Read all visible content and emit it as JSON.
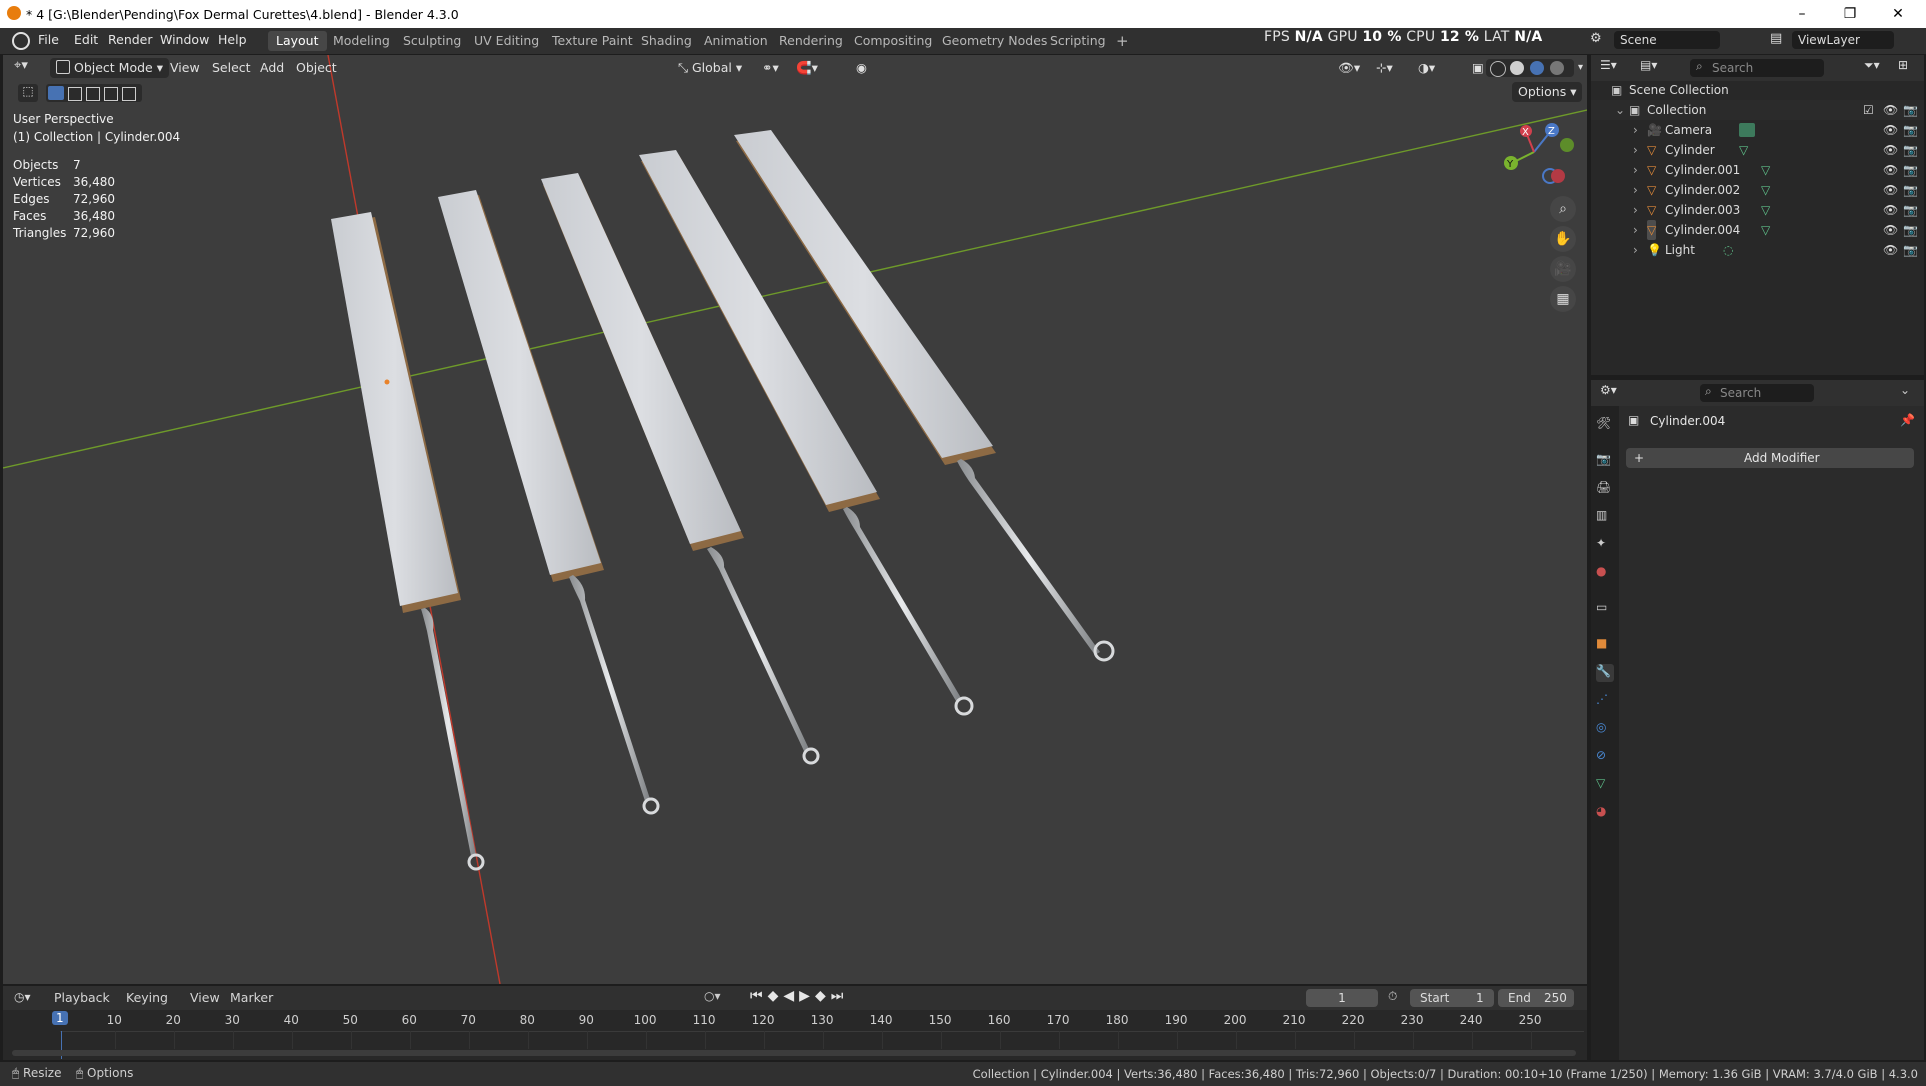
{
  "window": {
    "title": "* 4 [G:\\Blender\\Pending\\Fox Dermal Curettes\\4.blend] - Blender 4.3.0",
    "controls": [
      "–",
      "❐",
      "✕"
    ]
  },
  "menus": [
    "File",
    "Edit",
    "Render",
    "Window",
    "Help"
  ],
  "workspaces": [
    "Layout",
    "Modeling",
    "Sculpting",
    "UV Editing",
    "Texture Paint",
    "Shading",
    "Animation",
    "Rendering",
    "Compositing",
    "Geometry Nodes",
    "Scripting"
  ],
  "active_workspace": "Layout",
  "workspace_add": "+",
  "perf": {
    "fps_label": "FPS",
    "fps": "N/A",
    "gpu_label": "GPU",
    "gpu": "10 %",
    "cpu_label": "CPU",
    "cpu": "12 %",
    "lat_label": "LAT",
    "lat": "N/A"
  },
  "scene": {
    "label": "Scene",
    "view_layer": "ViewLayer"
  },
  "viewport": {
    "mode": "Object Mode",
    "menu": [
      "View",
      "Select",
      "Add",
      "Object"
    ],
    "orientation": "Global",
    "options_label": "Options",
    "perspective": "User Perspective",
    "context": "(1) Collection | Cylinder.004",
    "stats": [
      {
        "label": "Objects",
        "value": "7"
      },
      {
        "label": "Vertices",
        "value": "36,480"
      },
      {
        "label": "Edges",
        "value": "72,960"
      },
      {
        "label": "Faces",
        "value": "36,480"
      },
      {
        "label": "Triangles",
        "value": "72,960"
      }
    ],
    "gizmo": {
      "x": "X",
      "y": "Y",
      "z": "Z"
    }
  },
  "outliner": {
    "search_placeholder": "Search",
    "scene_collection": "Scene Collection",
    "collection": "Collection",
    "items": [
      "Camera",
      "Cylinder",
      "Cylinder.001",
      "Cylinder.002",
      "Cylinder.003",
      "Cylinder.004",
      "Light"
    ]
  },
  "properties": {
    "search_placeholder": "Search",
    "object_name": "Cylinder.004",
    "add_modifier": "Add Modifier",
    "add_icon": "+"
  },
  "timeline": {
    "menus": [
      "Playback",
      "Keying",
      "View",
      "Marker"
    ],
    "current_frame": "1",
    "start_label": "Start",
    "start": "1",
    "end_label": "End",
    "end": "250",
    "ticks": [
      "1",
      "10",
      "20",
      "30",
      "40",
      "50",
      "60",
      "70",
      "80",
      "90",
      "100",
      "110",
      "120",
      "130",
      "140",
      "150",
      "160",
      "170",
      "180",
      "190",
      "200",
      "210",
      "220",
      "230",
      "240",
      "250"
    ]
  },
  "statusbar": {
    "left": [
      "Resize",
      "Options"
    ],
    "right": "Collection | Cylinder.004 | Verts:36,480 | Faces:36,480 | Tris:72,960 | Objects:0/7 | Duration: 00:10+10 (Frame 1/250) | Memory: 1.36 GiB | VRAM: 3.7/4.0 GiB | 4.3.0"
  },
  "colors": {
    "viewport_bg": "#3d3d3d",
    "x_axis": "#c0392b",
    "y_axis": "#6e9a2a",
    "accent": "#4772b3",
    "active_tab": "#474747"
  }
}
